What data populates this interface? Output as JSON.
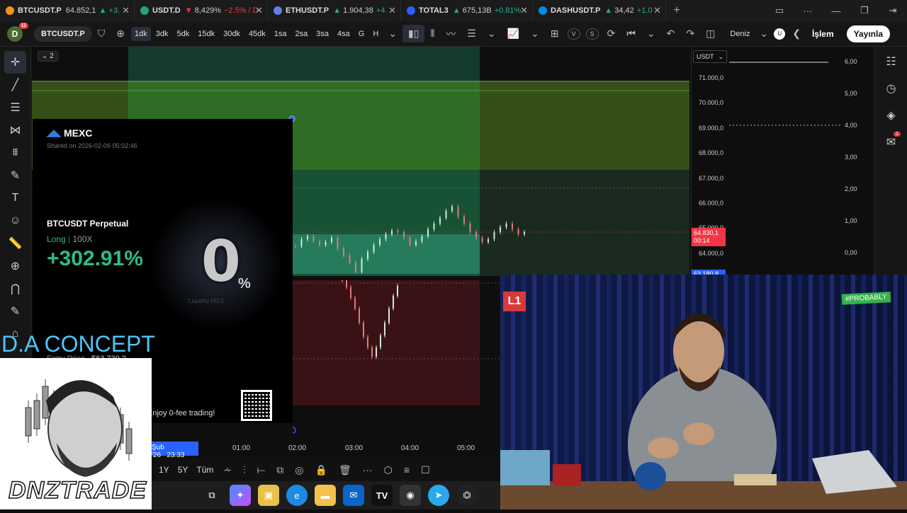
{
  "tabs": [
    {
      "symbol": "BTCUSDT.P",
      "price": "64.852,1",
      "change": "+3.",
      "dir": "up",
      "color": "#f7931a"
    },
    {
      "symbol": "USDT.D",
      "price": "8,429%",
      "change": "−2.5% / D",
      "dir": "down",
      "color": "#26a17b"
    },
    {
      "symbol": "ETHUSDT.P",
      "price": "1.904,38",
      "change": "+4.",
      "dir": "up",
      "color": "#627eea"
    },
    {
      "symbol": "TOTAL3",
      "price": "675,13B",
      "change": "+0.81%",
      "dir": "up",
      "color": "#2962ff"
    },
    {
      "symbol": "DASHUSDT.P",
      "price": "34,42",
      "change": "+1.0",
      "dir": "up",
      "color": "#008de4"
    }
  ],
  "toolbar": {
    "avatar_letter": "D",
    "avatar_badge": "11",
    "symbol": "BTCUSDT.P",
    "timeframes": [
      "1dk",
      "3dk",
      "5dk",
      "15dk",
      "30dk",
      "45dk",
      "1sa",
      "2sa",
      "3sa",
      "4sa",
      "G",
      "H"
    ],
    "active_timeframe": "1dk",
    "v_label": "V",
    "s_label": "S",
    "profile_name": "Deniz",
    "profile_initial": "U",
    "trade_label": "İşlem",
    "publish_label": "Yayınla"
  },
  "chart": {
    "currency": "USDT",
    "layout_count": "2",
    "price_labels": [
      "71.000,0",
      "70.000,0",
      "69.000,0",
      "68.000,0",
      "67.000,0",
      "66.000,0",
      "65.000,0",
      "64.000,0",
      "63.180,8"
    ],
    "last_price": "64.830,1",
    "countdown": "00:14",
    "indicator_labels": [
      "6,00",
      "5,00",
      "4,00",
      "3,00",
      "2,00",
      "1,00",
      "0,00"
    ],
    "time_labels": [
      "Şub '26",
      "23:33",
      "01:00",
      "02:00",
      "03:00",
      "04:00",
      "05:00"
    ],
    "range_buttons": [
      "1Y",
      "5Y",
      "Tüm"
    ],
    "right_badge": "1"
  },
  "card": {
    "brand": "MEXC",
    "shared_on": "Shared on 2026-02-06 05:02:46",
    "pair": "BTCUSDT Perpetual",
    "side": "Long",
    "leverage": "100X",
    "pnl": "+302.91%",
    "promo_big": "0",
    "promo_pct": "%",
    "promo_sub": "Liquidity NO.1",
    "entry_label": "Entry Price",
    "entry_value": "$63,730.2",
    "tagline": "Enjoy 0-fee trading!"
  },
  "overlay": {
    "concept": "D.A CONCEPT",
    "brand": "DNZTRADE",
    "channel_logo": "L1",
    "probably_tag": "#PROBABLY"
  },
  "colors": {
    "up": "#22ab94",
    "down": "#f23645",
    "accent": "#2962ff",
    "pnl": "#2ebd85"
  }
}
